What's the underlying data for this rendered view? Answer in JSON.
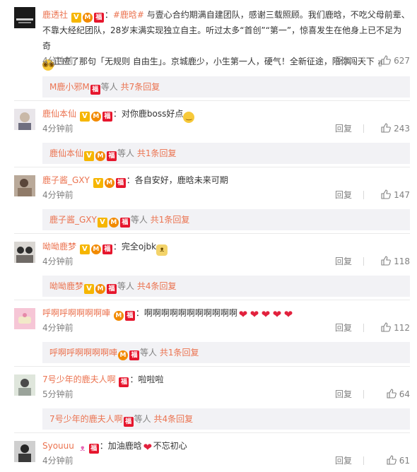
{
  "comments": [
    {
      "user": "鹿透社",
      "badges": [
        "V",
        "M",
        "R"
      ],
      "colon": "：",
      "topic": "#鹿晗#",
      "text": " 与壹心合约期满自建团队，感谢三载照顾。我们鹿晗，不吃父母前辈、不靠大经纪团队，28岁末满实现独立自主。听过太多“首创”“第一”，惊喜发生在他身上已不足为奇",
      "text2": "正应了那句「无规则 自由生」。京城鹿少，小生第一人，硬气！全新征途，陪你闯天下",
      "time": "4分钟前",
      "reply": "回复",
      "likes": "627",
      "sub": {
        "user": "M鹿小邪M",
        "suffix": "等人",
        "more": "共7条回复"
      }
    },
    {
      "user": "鹿仙本仙",
      "badges": [
        "V",
        "M",
        "R"
      ],
      "colon": "：",
      "text": "对你鹿boss好点",
      "time": "4分钟前",
      "reply": "回复",
      "likes": "243",
      "sub": {
        "user": "鹿仙本仙",
        "suffix": "等人",
        "more": "共1条回复"
      }
    },
    {
      "user": "鹿子酱_GXY",
      "badges": [
        "V",
        "M",
        "R"
      ],
      "colon": "：",
      "text": "各自安好，鹿晗未来可期",
      "time": "4分钟前",
      "reply": "回复",
      "likes": "147",
      "sub": {
        "user": "鹿子酱_GXY",
        "suffix": "等人",
        "more": "共1条回复"
      }
    },
    {
      "user": "呦呦鹿梦",
      "badges": [
        "V",
        "M",
        "R"
      ],
      "colon": "：",
      "text": "完全ojbk",
      "time": "4分钟前",
      "reply": "回复",
      "likes": "118",
      "sub": {
        "user": "呦呦鹿梦",
        "suffix": "等人",
        "more": "共4条回复"
      }
    },
    {
      "user": "呼啊呼啊啊啊啊唓",
      "badges": [
        "M",
        "R"
      ],
      "colon": "：",
      "text": "啊啊啊啊啊啊啊啊啊啊啊",
      "time": "4分钟前",
      "reply": "回复",
      "likes": "112",
      "sub": {
        "user": "呼啊呼啊啊啊啊唓",
        "suffix": "等人",
        "more": "共1条回复"
      }
    },
    {
      "user": "7号少年的鹿夫人啊",
      "badges": [
        "R"
      ],
      "colon": "：",
      "text": "啦啦啦",
      "time": "5分钟前",
      "reply": "回复",
      "likes": "64",
      "sub": {
        "user": "7号少年的鹿夫人啊",
        "suffix": "等人",
        "more": "共4条回复"
      }
    },
    {
      "user": "Syouuu",
      "badges": [
        "R"
      ],
      "colon": "：",
      "text": "加油鹿晗",
      "text2": "不忘初心",
      "time": "4分钟前",
      "reply": "回复",
      "likes": "61"
    }
  ],
  "colors": {
    "accent": "#eb7350",
    "meta": "#808080",
    "subBg": "#f2f2f5",
    "vip": "#f6b600",
    "member": "#f28a00",
    "red": "#e6162d"
  }
}
